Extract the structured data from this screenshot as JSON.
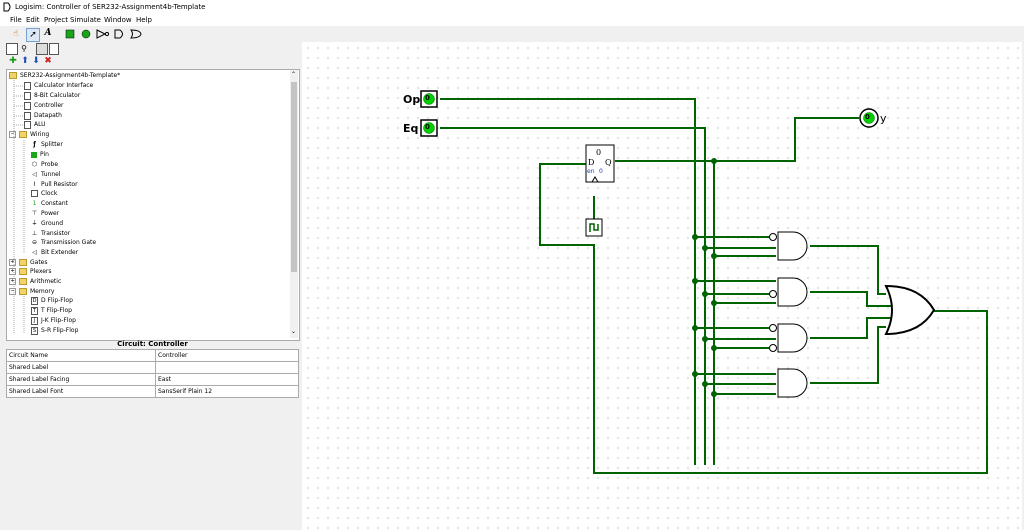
{
  "window": {
    "title": "Logisim: Controller of SER232-Assignment4b-Template"
  },
  "menu": [
    "File",
    "Edit",
    "Project",
    "Simulate",
    "Window",
    "Help"
  ],
  "explorer": {
    "items": [
      {
        "label": "SER232-Assignment4b-Template*",
        "icon": "folder-icon"
      },
      {
        "label": "Calculator Interface",
        "icon": "circuit-icon"
      },
      {
        "label": "8-Bit Calculator",
        "icon": "circuit-icon"
      },
      {
        "label": "Controller",
        "icon": "circuit-icon"
      },
      {
        "label": "Datapath",
        "icon": "circuit-icon"
      },
      {
        "label": "ALU",
        "icon": "circuit-icon"
      },
      {
        "label": "Wiring",
        "icon": "folder-icon"
      },
      {
        "label": "Splitter",
        "icon": "splitter-icon"
      },
      {
        "label": "Pin",
        "icon": "pin-icon"
      },
      {
        "label": "Probe",
        "icon": "probe-icon"
      },
      {
        "label": "Tunnel",
        "icon": "tunnel-icon"
      },
      {
        "label": "Pull Resistor",
        "icon": "resistor-icon"
      },
      {
        "label": "Clock",
        "icon": "clock-icon"
      },
      {
        "label": "Constant",
        "icon": "constant-icon"
      },
      {
        "label": "Power",
        "icon": "power-icon"
      },
      {
        "label": "Ground",
        "icon": "ground-icon"
      },
      {
        "label": "Transistor",
        "icon": "transistor-icon"
      },
      {
        "label": "Transmission Gate",
        "icon": "transmission-gate-icon"
      },
      {
        "label": "Bit Extender",
        "icon": "bit-extender-icon"
      },
      {
        "label": "Gates",
        "icon": "folder-icon"
      },
      {
        "label": "Plexers",
        "icon": "folder-icon"
      },
      {
        "label": "Arithmetic",
        "icon": "folder-icon"
      },
      {
        "label": "Memory",
        "icon": "folder-icon"
      },
      {
        "label": "D Flip-Flop",
        "icon": "flipflop-icon"
      },
      {
        "label": "T Flip-Flop",
        "icon": "flipflop-icon"
      },
      {
        "label": "J-K Flip-Flop",
        "icon": "flipflop-icon"
      },
      {
        "label": "S-R Flip-Flop",
        "icon": "flipflop-icon"
      }
    ]
  },
  "attributes": {
    "title": "Circuit: Controller",
    "rows": [
      {
        "name": "Circuit Name",
        "value": "Controller"
      },
      {
        "name": "Shared Label",
        "value": ""
      },
      {
        "name": "Shared Label Facing",
        "value": "East"
      },
      {
        "name": "Shared Label Font",
        "value": "SansSerif Plain 12"
      }
    ]
  },
  "circuit": {
    "input_op_label": "Op",
    "input_eq_label": "Eq",
    "output_label": "y",
    "input_op_value": "0",
    "input_eq_value": "0",
    "output_value": "0",
    "ff_q_value": "0",
    "ff_d_label": "D",
    "ff_q_label": "Q",
    "ff_en_label": "en",
    "ff_en_value": "0",
    "wire_color": "#006400"
  }
}
